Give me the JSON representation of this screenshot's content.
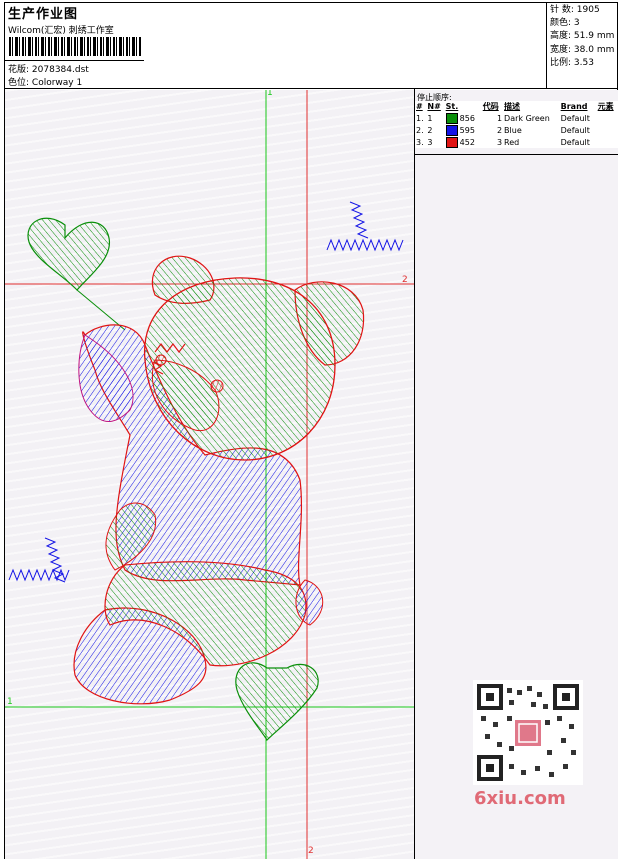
{
  "header": {
    "title": "生产作业图",
    "company": "Wilcom(汇宏) 刺绣工作室",
    "design_label": "花版:",
    "design_value": "2078384.dst",
    "colorway_label": "色位:",
    "colorway_value": "Colorway 1"
  },
  "stats": {
    "stitches_label": "针 数:",
    "stitches_value": "1905",
    "colors_label": "颜色:",
    "colors_value": "3",
    "height_label": "高度:",
    "height_value": "51.9 mm",
    "width_label": "宽度:",
    "width_value": "38.0 mm",
    "ratio_label": "比例:",
    "ratio_value": "3.53"
  },
  "stop_sequence": {
    "heading": "停止顺序:",
    "columns": [
      "#",
      "N#",
      "St.",
      "代码",
      "描述",
      "Brand",
      "元素"
    ],
    "rows": [
      {
        "index": "1.",
        "n": "1",
        "color": "#0a8f0a",
        "st": "856",
        "code": "1",
        "desc": "Dark Green",
        "brand": "Default",
        "element": ""
      },
      {
        "index": "2.",
        "n": "2",
        "color": "#1414e6",
        "st": "595",
        "code": "2",
        "desc": "Blue",
        "brand": "Default",
        "element": ""
      },
      {
        "index": "3.",
        "n": "3",
        "color": "#e01414",
        "st": "452",
        "code": "3",
        "desc": "Red",
        "brand": "Default",
        "element": ""
      }
    ]
  },
  "guides": {
    "v_top": "1",
    "h_right": "2",
    "h_left": "1",
    "v_bottom": "2"
  },
  "watermark": {
    "text": "6xiu.com"
  },
  "colors": {
    "green": "#0a8f0a",
    "blue": "#1414e6",
    "red": "#e01414",
    "guide_green": "#19c819",
    "guide_red": "#e03030"
  }
}
